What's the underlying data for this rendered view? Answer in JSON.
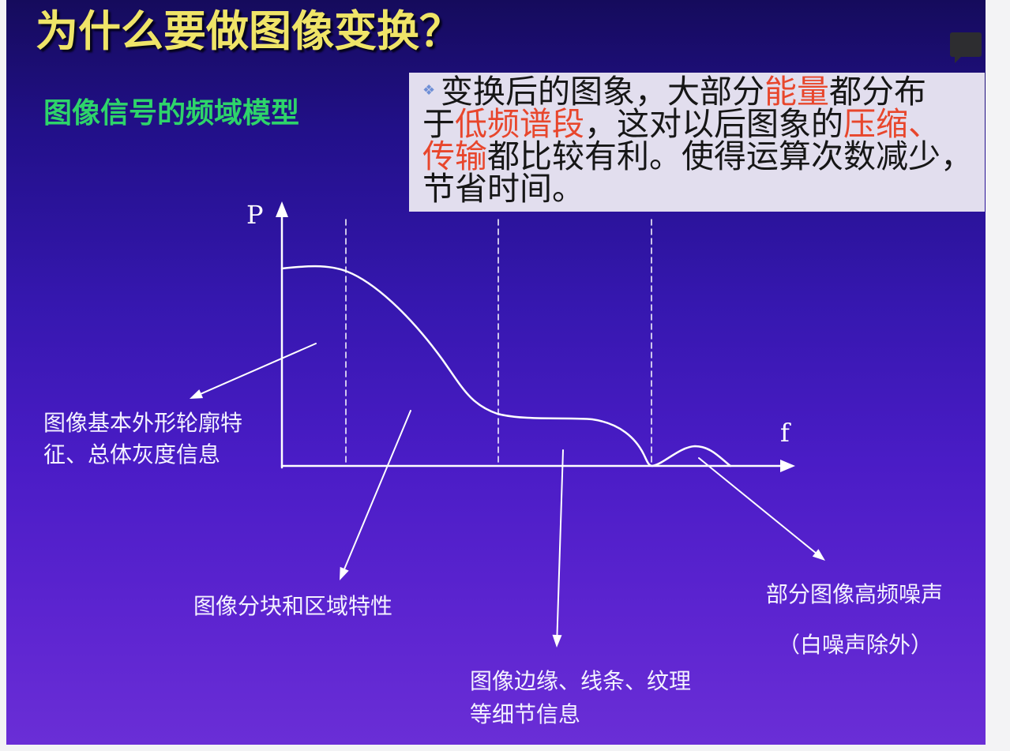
{
  "slide": {
    "title": "为什么要做图像变换？",
    "subtitle": "图像信号的频域模型",
    "callout": {
      "bullet": "❖",
      "lines": [
        [
          {
            "text": "变换后的图象，大部分",
            "highlight": false
          },
          {
            "text": "能量",
            "highlight": true
          },
          {
            "text": "都分布",
            "highlight": false
          }
        ],
        [
          {
            "text": "于",
            "highlight": false
          },
          {
            "text": "低频谱段",
            "highlight": true
          },
          {
            "text": "，这对以后图象的",
            "highlight": false
          },
          {
            "text": "压缩、",
            "highlight": true
          }
        ],
        [
          {
            "text": "传输",
            "highlight": true
          },
          {
            "text": "都比较有利。使得运算次数减少，",
            "highlight": false
          }
        ],
        [
          {
            "text": "节省时间。",
            "highlight": false
          }
        ]
      ]
    },
    "diagram": {
      "y_axis_label": "P",
      "x_axis_label": "f",
      "annotations": {
        "low_frequency": [
          "图像基本外形轮廓特",
          "征、总体灰度信息"
        ],
        "mid_frequency": "图像分块和区域特性",
        "detail": [
          "图像边缘、线条、纹理",
          "等细节信息"
        ],
        "noise": [
          "部分图像高频噪声",
          "（白噪声除外）"
        ]
      }
    }
  },
  "overlay": {
    "icon": "comment-icon"
  },
  "colors": {
    "title": "#efe468",
    "subtitle": "#2ed46a",
    "highlight": "#e8462c",
    "callout_bg": "#e2deee",
    "callout_text": "#161616",
    "bullet": "#6f8fd6",
    "diagram": "#ffffff",
    "label": "#f4f2ff",
    "background_top": "#150b5c",
    "background_bottom": "#6a2ed6",
    "icon": "#2d2d30"
  }
}
